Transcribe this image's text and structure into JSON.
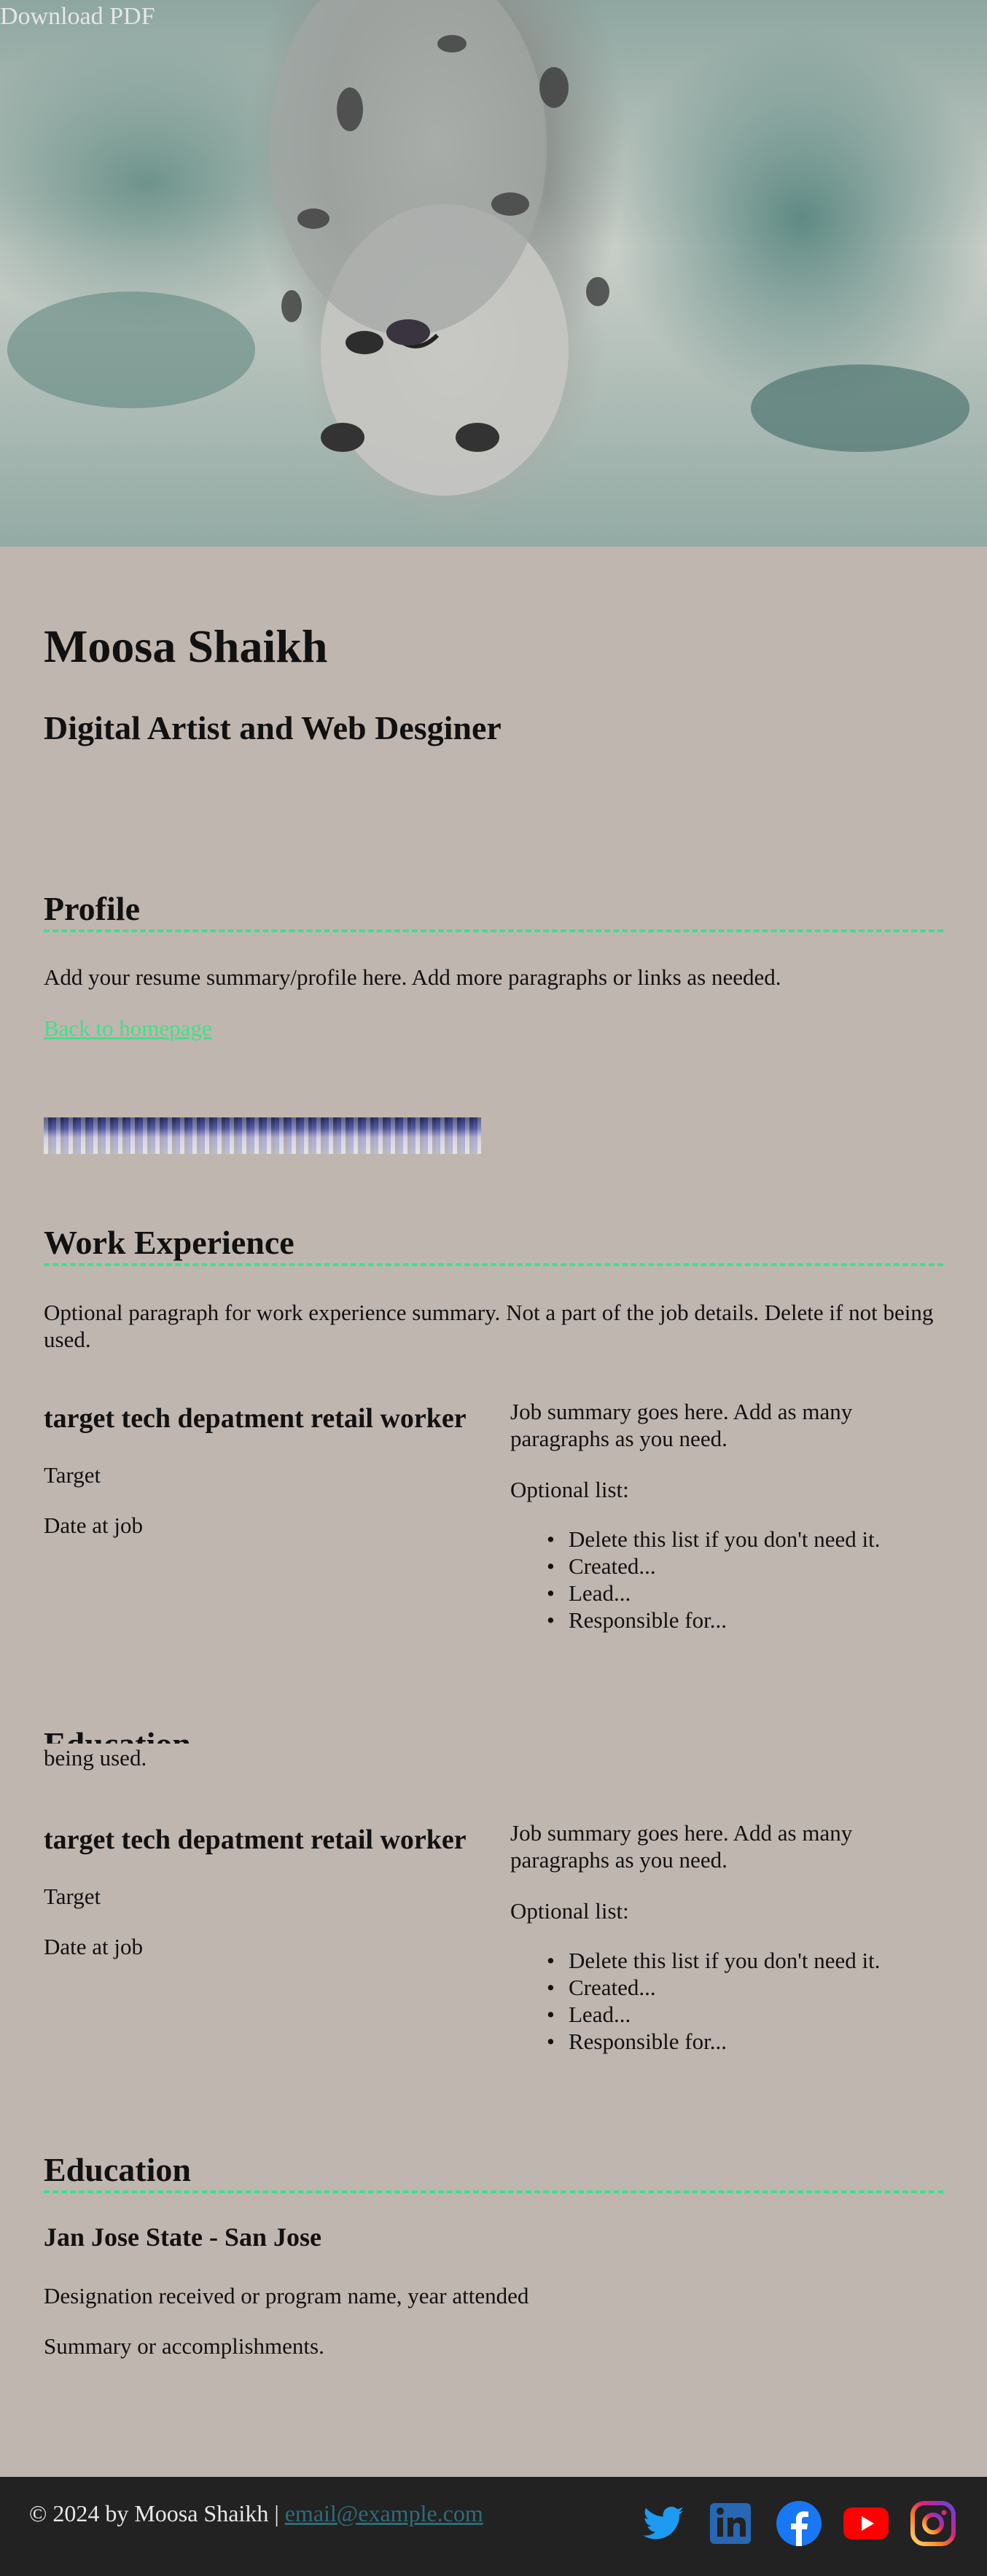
{
  "hero": {
    "download_label": "Download PDF",
    "image_icon": "snow-leopard-photo"
  },
  "header": {
    "name": "Moosa Shaikh",
    "role": "Digital Artist and Web Desginer"
  },
  "profile": {
    "title": "Profile",
    "summary": "Add your resume summary/profile here. Add more paragraphs or links as needed.",
    "back_link": "Back to homepage"
  },
  "work": {
    "title": "Work Experience",
    "summary": "Optional paragraph for work experience summary. Not a part of the job details. Delete if not being used.",
    "overlap_fragment": "being used.",
    "jobs": [
      {
        "title": "target tech depatment retail worker",
        "company": "Target",
        "date": "Date at job",
        "summary": "Job summary goes here. Add as many paragraphs as you need.",
        "list_label": "Optional list:",
        "items": [
          "Delete this list if you don't need it.",
          "Created...",
          "Lead...",
          "Responsible for..."
        ]
      },
      {
        "title": "target tech depatment retail worker",
        "company": "Target",
        "date": "Date at job",
        "summary": "Job summary goes here. Add as many paragraphs as you need.",
        "list_label": "Optional list:",
        "items": [
          "Delete this list if you don't need it.",
          "Created...",
          "Lead...",
          "Responsible for..."
        ]
      }
    ]
  },
  "education": {
    "title": "Education",
    "school": "Jan Jose State - San Jose",
    "designation": "Designation received or program name, year attended",
    "summary": "Summary or accomplishments."
  },
  "footer": {
    "text": "© 2024 by Moosa Shaikh |",
    "email": "email@example.com",
    "socials": [
      "twitter-icon",
      "linkedin-icon",
      "facebook-icon",
      "youtube-icon",
      "instagram-icon"
    ]
  },
  "colors": {
    "background": "#c0b6b0",
    "accent": "#3fe08a",
    "footer": "#222222"
  }
}
